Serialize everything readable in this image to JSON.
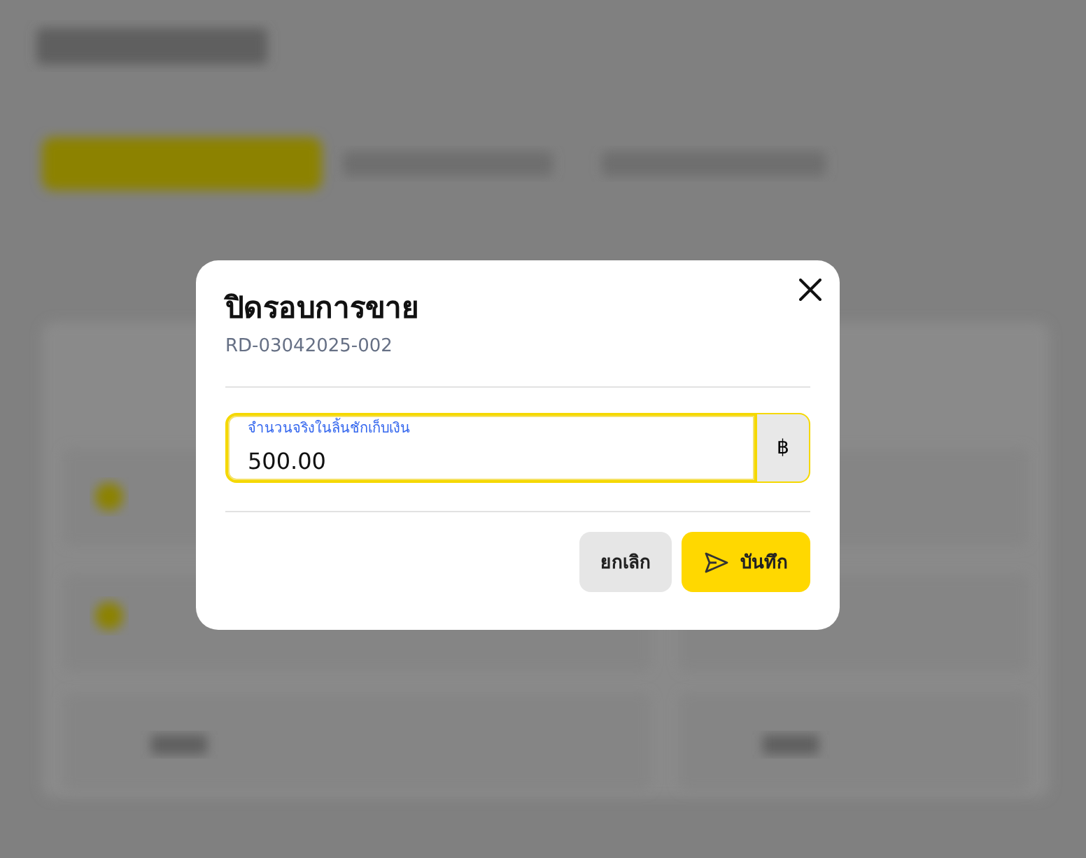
{
  "dialog": {
    "title": "ปิดรอบการขาย",
    "subtitle": "RD-03042025-002",
    "field": {
      "label": "จำนวนจริงในลิ้นชักเก็บเงิน",
      "value": "500.00",
      "focused": true,
      "suffix": "฿"
    },
    "buttons": [
      {
        "label": "ยกเลิก",
        "kind": "cancel"
      },
      {
        "label": "บันทึก",
        "kind": "submit"
      }
    ]
  }
}
